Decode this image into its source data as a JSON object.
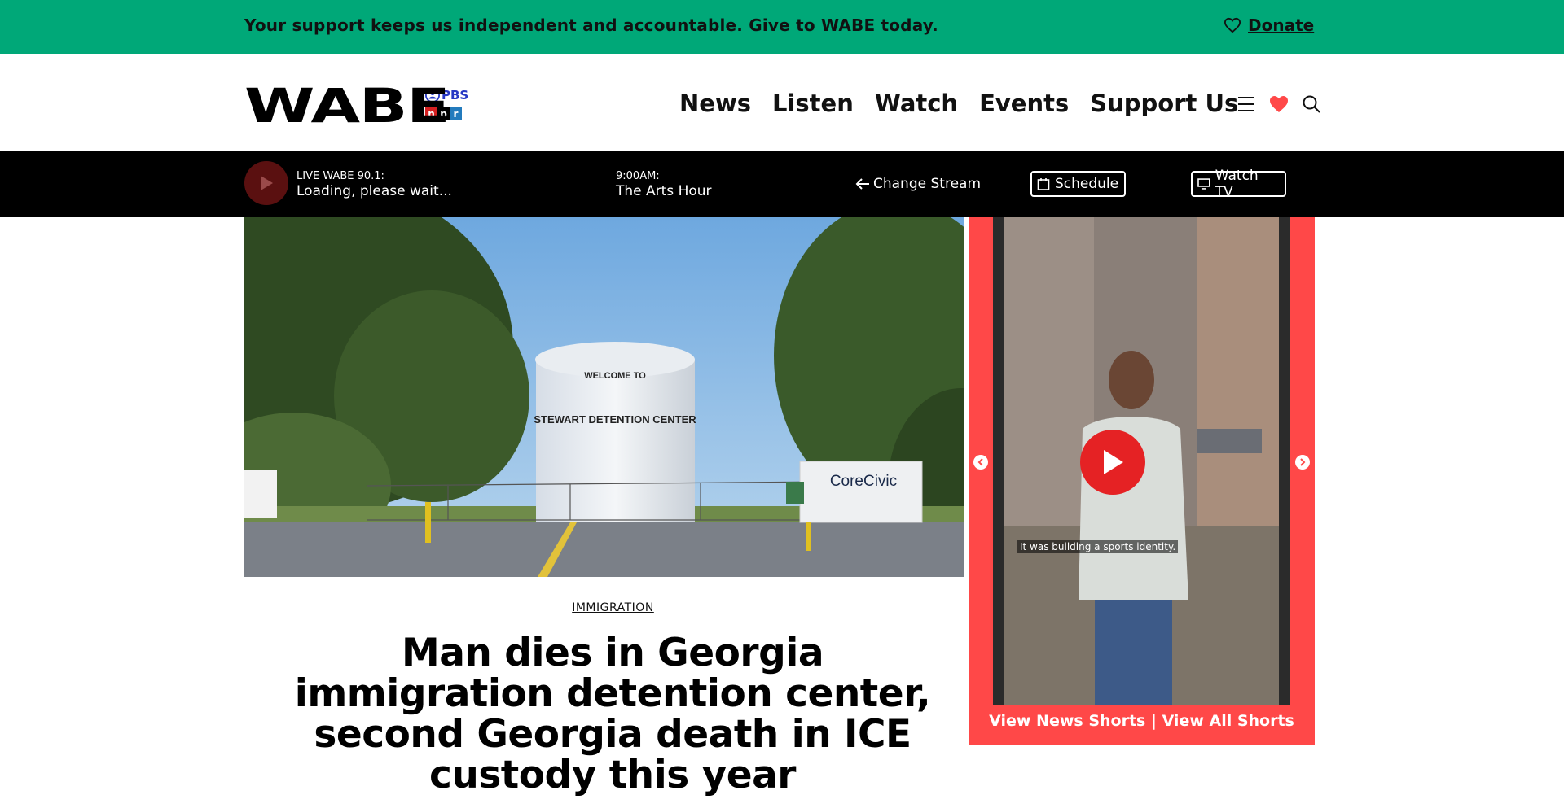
{
  "banner": {
    "message": "Your support keeps us independent and accountable. Give to WABE today.",
    "donate_label": "Donate"
  },
  "header": {
    "logo_text": "WABE",
    "pbs_label": "PBS",
    "npr_letters": [
      "n",
      "p",
      "r"
    ],
    "nav": [
      "News",
      "Listen",
      "Watch",
      "Events",
      "Support Us"
    ]
  },
  "player": {
    "live_label": "LIVE WABE 90.1:",
    "live_status": "Loading, please wait...",
    "time_label": "9:00AM:",
    "show_name": "The Arts Hour",
    "change_stream": "Change Stream",
    "schedule": "Schedule",
    "watch_tv": "Watch TV"
  },
  "hero": {
    "sign_line1": "WELCOME TO",
    "sign_line2": "STEWART DETENTION CENTER",
    "company_sign": "CoreCivic"
  },
  "shorts": {
    "caption": "It was building a sports identity.",
    "links": [
      "View News Shorts",
      "View All Shorts"
    ],
    "separator": "|"
  },
  "article": {
    "category": "IMMIGRATION",
    "headline": "Man dies in Georgia immigration detention center, second Georgia death in ICE custody this year"
  },
  "colors": {
    "banner_green": "#00a878",
    "shorts_red": "#ff4848",
    "play_red": "#e52224",
    "npr_red": "#d62021",
    "npr_black": "#000000",
    "npr_blue": "#237bbd",
    "pbs_blue": "#2638c4"
  }
}
